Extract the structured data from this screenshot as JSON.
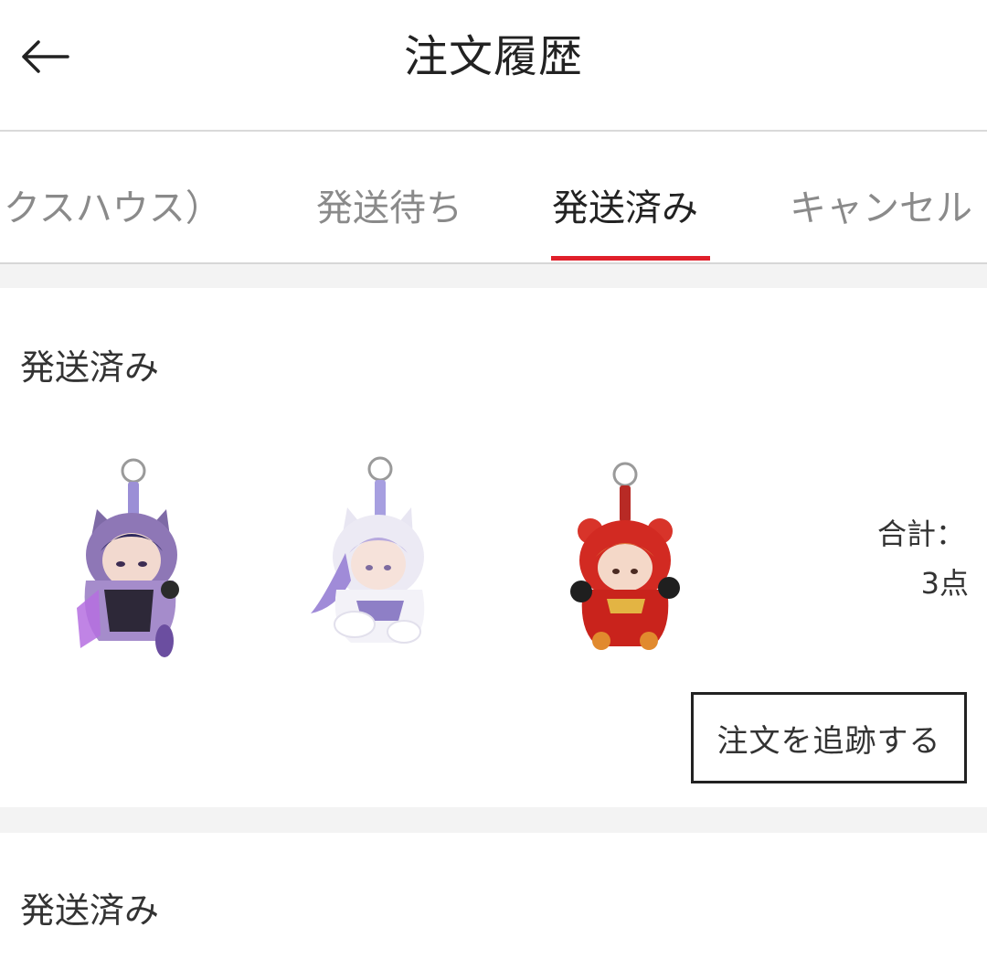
{
  "header": {
    "title": "注文履歴",
    "back_icon": "arrow-left-icon"
  },
  "tabs": [
    {
      "label": "クスハウス）",
      "active": false
    },
    {
      "label": "発送待ち",
      "active": false
    },
    {
      "label": "発送済み",
      "active": true
    },
    {
      "label": "キャンセル",
      "active": false
    }
  ],
  "orders": [
    {
      "status": "発送済み",
      "products": [
        {
          "name": "purple-cat-keychain-figure",
          "color": "#8c6bb0"
        },
        {
          "name": "white-fox-keychain-figure",
          "color": "#d9d6ec"
        },
        {
          "name": "red-lion-keychain-figure",
          "color": "#d7261d"
        }
      ],
      "total_label": "合計：",
      "total_count": "3点",
      "track_button": "注文を追跡する"
    },
    {
      "status": "発送済み"
    }
  ],
  "colors": {
    "accent": "#e0202b",
    "tab_inactive": "#8a8a8a",
    "text": "#222222",
    "divider": "#f3f3f3"
  }
}
